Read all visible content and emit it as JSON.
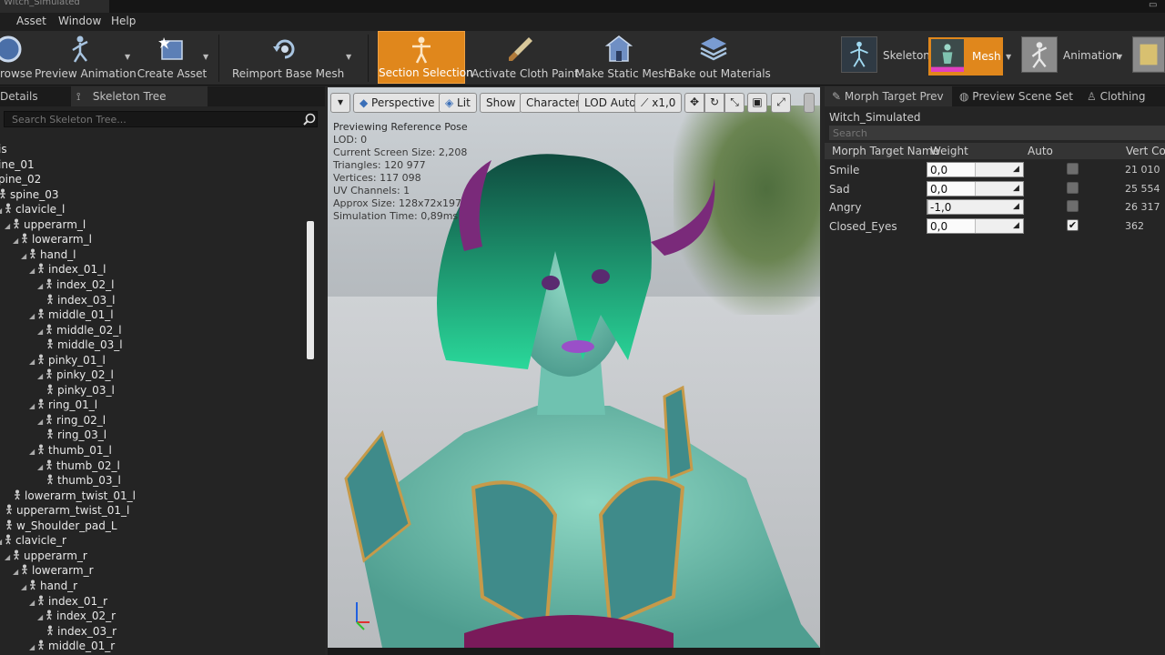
{
  "window": {
    "title": "Witch_Simulated"
  },
  "menu": [
    "Asset",
    "Window",
    "Help"
  ],
  "toolbar": {
    "buttons": [
      {
        "label": "rowse",
        "icon": "browse-icon"
      },
      {
        "label": "Preview Animation",
        "icon": "preview-animation-icon"
      },
      {
        "label": "Create Asset",
        "icon": "create-asset-icon"
      },
      {
        "label": "Reimport Base Mesh",
        "icon": "reimport-icon"
      },
      {
        "label": "Section Selection",
        "icon": "section-selection-icon",
        "active": true
      },
      {
        "label": "Activate Cloth Paint",
        "icon": "cloth-paint-icon"
      },
      {
        "label": "Make Static Mesh",
        "icon": "static-mesh-icon"
      },
      {
        "label": "Bake out Materials",
        "icon": "bake-materials-icon"
      }
    ],
    "modes": [
      {
        "label": "Skeleton"
      },
      {
        "label": "Mesh",
        "active": true
      },
      {
        "label": "Animation"
      }
    ],
    "accent_color": "#e0871c"
  },
  "left_panel": {
    "tabs": [
      "Details",
      "Skeleton Tree"
    ],
    "search_placeholder": "Search Skeleton Tree...",
    "bones": [
      {
        "name": "is"
      },
      {
        "name": "ine_01"
      },
      {
        "name": "pine_02"
      },
      {
        "name": "spine_03"
      },
      {
        "name": "clavicle_l"
      },
      {
        "name": "upperarm_l"
      },
      {
        "name": "lowerarm_l"
      },
      {
        "name": "hand_l"
      },
      {
        "name": "index_01_l"
      },
      {
        "name": "index_02_l"
      },
      {
        "name": "index_03_l"
      },
      {
        "name": "middle_01_l"
      },
      {
        "name": "middle_02_l"
      },
      {
        "name": "middle_03_l"
      },
      {
        "name": "pinky_01_l"
      },
      {
        "name": "pinky_02_l"
      },
      {
        "name": "pinky_03_l"
      },
      {
        "name": "ring_01_l"
      },
      {
        "name": "ring_02_l"
      },
      {
        "name": "ring_03_l"
      },
      {
        "name": "thumb_01_l"
      },
      {
        "name": "thumb_02_l"
      },
      {
        "name": "thumb_03_l"
      },
      {
        "name": "lowerarm_twist_01_l"
      },
      {
        "name": "upperarm_twist_01_l"
      },
      {
        "name": "w_Shoulder_pad_L"
      },
      {
        "name": "clavicle_r"
      },
      {
        "name": "upperarm_r"
      },
      {
        "name": "lowerarm_r"
      },
      {
        "name": "hand_r"
      },
      {
        "name": "index_01_r"
      },
      {
        "name": "index_02_r"
      },
      {
        "name": "index_03_r"
      },
      {
        "name": "middle_01_r"
      }
    ]
  },
  "viewport": {
    "buttons": {
      "perspective": "Perspective",
      "lit": "Lit",
      "show": "Show",
      "character": "Character",
      "lod": "LOD Auto",
      "speed": "x1,0"
    },
    "stats": [
      "Previewing Reference Pose",
      "LOD: 0",
      "Current Screen Size: 2,208",
      "Triangles: 120 977",
      "Vertices: 117 098",
      "UV Channels: 1",
      "Approx Size: 128x72x197",
      "Simulation Time: 0,89ms"
    ]
  },
  "right_panel": {
    "tabs": [
      "Morph Target Prev",
      "Preview Scene Set",
      "Clothing"
    ],
    "mesh_name": "Witch_Simulated",
    "search_placeholder": "Search",
    "columns": [
      "Morph Target Name",
      "Weight",
      "Auto",
      "Vert Cou"
    ],
    "morph_targets": [
      {
        "name": "Smile",
        "weight": "0,0",
        "level": 0.5,
        "auto": false,
        "verts": "21 010"
      },
      {
        "name": "Sad",
        "weight": "0,0",
        "level": 0.5,
        "auto": false,
        "verts": "25 554"
      },
      {
        "name": "Angry",
        "weight": "-1,0",
        "level": 0.0,
        "auto": false,
        "verts": "26 317"
      },
      {
        "name": "Closed_Eyes",
        "weight": "0,0",
        "level": 0.5,
        "auto": true,
        "verts": "362"
      }
    ]
  }
}
